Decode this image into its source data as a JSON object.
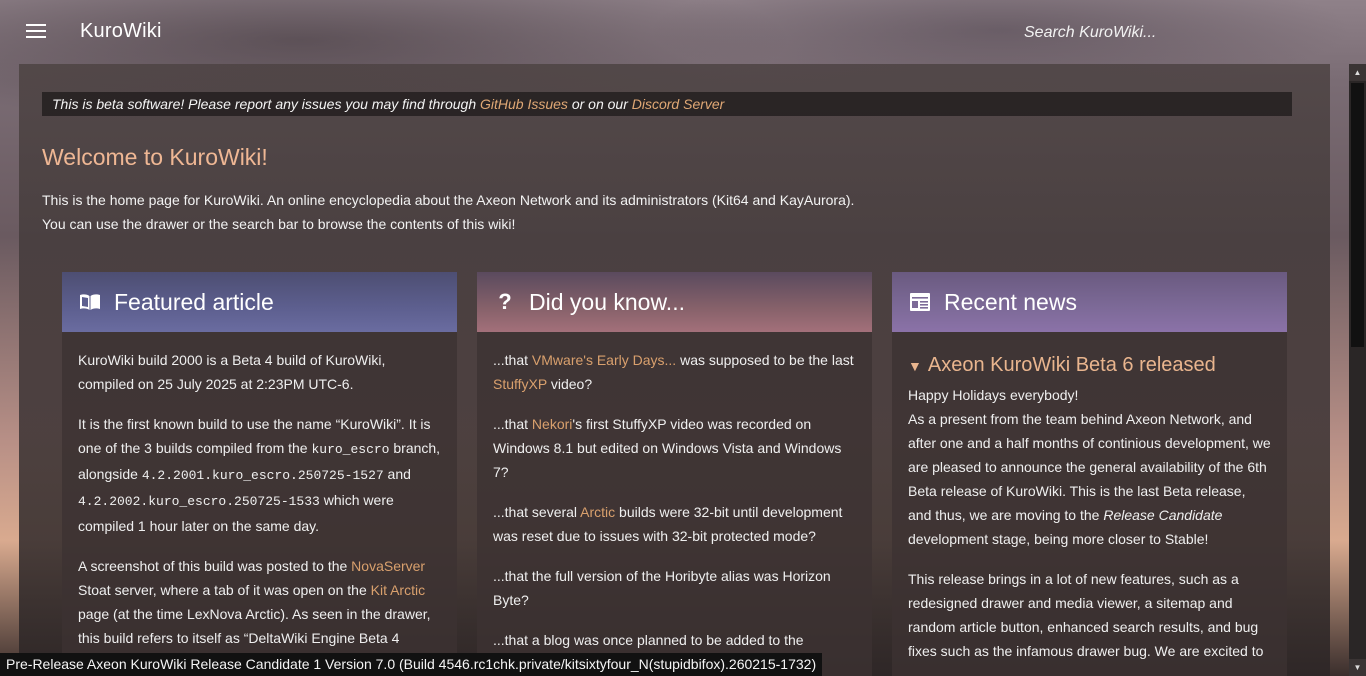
{
  "topbar": {
    "site_title": "KuroWiki",
    "search_placeholder": "Search KuroWiki..."
  },
  "banner": {
    "prefix": "This is beta software! Please report any issues you may find through ",
    "link1": "GitHub Issues",
    "middle": " or on our ",
    "link2": "Discord Server"
  },
  "main": {
    "heading": "Welcome to KuroWiki!",
    "intro_line1": "This is the home page for KuroWiki. An online encyclopedia about the Axeon Network and its administrators (Kit64 and KayAurora).",
    "intro_line2": "You can use the drawer or the search bar to browse the contents of this wiki!"
  },
  "featured": {
    "title": "Featured article",
    "icon": "book-icon",
    "p1": "KuroWiki build 2000 is a Beta 4 build of KuroWiki, compiled on 25 July 2025 at 2:23PM UTC-6.",
    "p2_a": "It is the first known build to use the name “KuroWiki”. It is one of the 3 builds compiled from the ",
    "p2_branch": "kuro_escro",
    "p2_b": " branch, alongside ",
    "p2_build1": "4.2.2001.kuro_escro.250725-1527",
    "p2_c": " and ",
    "p2_build2": "4.2.2002.kuro_escro.250725-1533",
    "p2_d": " which were compiled 1 hour later on the same day.",
    "p3_a": "A screenshot of this build was posted to the ",
    "p3_link1": "NovaServer",
    "p3_b": " Stoat server, where a tab of it was open on the ",
    "p3_link2": "Kit Arctic",
    "p3_c": " page (at the time LexNova Arctic). As seen in the drawer, this build refers to itself as “DeltaWiki Engine Beta 4"
  },
  "know": {
    "title": "Did you know...",
    "icon": "question-icon",
    "f1_a": "...that ",
    "f1_link": "VMware's Early Days...",
    "f1_b": " was supposed to be the last ",
    "f1_link2": "StuffyXP",
    "f1_c": " video?",
    "f2_a": "...that ",
    "f2_link": "Nekori",
    "f2_b": "'s first StuffyXP video was recorded on Windows 8.1 but edited on Windows Vista and Windows 7?",
    "f3_a": "...that several ",
    "f3_link": "Arctic",
    "f3_b": " builds were 32-bit until development was reset due to issues with 32-bit protected mode?",
    "f4": "...that the full version of the Horibyte alias was Horizon Byte?",
    "f5": "...that a blog was once planned to be added to the"
  },
  "news": {
    "title": "Recent news",
    "icon": "newspaper-icon",
    "item_title": "Axeon KuroWiki Beta 6 released",
    "p1_line1": "Happy Holidays everybody!",
    "p1_a": "As a present from the team behind Axeon Network, and after one and a half months of continious development, we are pleased to announce the general availability of the 6th Beta release of KuroWiki. This is the last Beta release, and thus, we are moving to the ",
    "p1_em": "Release Candidate",
    "p1_b": " development stage, being more closer to Stable!",
    "p2": "This release brings in a lot of new features, such as a redesigned drawer and media viewer, a sitemap and random article button, enhanced search results, and bug fixes such as the infamous drawer bug. We are excited to"
  },
  "statusbar": {
    "text": "Pre-Release Axeon KuroWiki Release Candidate 1 Version 7.0 (Build 4546.rc1chk.private/kitsixtyfour_N(stupidbifox).260215-1732)"
  },
  "colors": {
    "link": "#d9a06d",
    "heading": "#efb794",
    "featured_header": "#5d5f8f",
    "know_header": "#86616a",
    "news_header": "#7d6a98"
  }
}
